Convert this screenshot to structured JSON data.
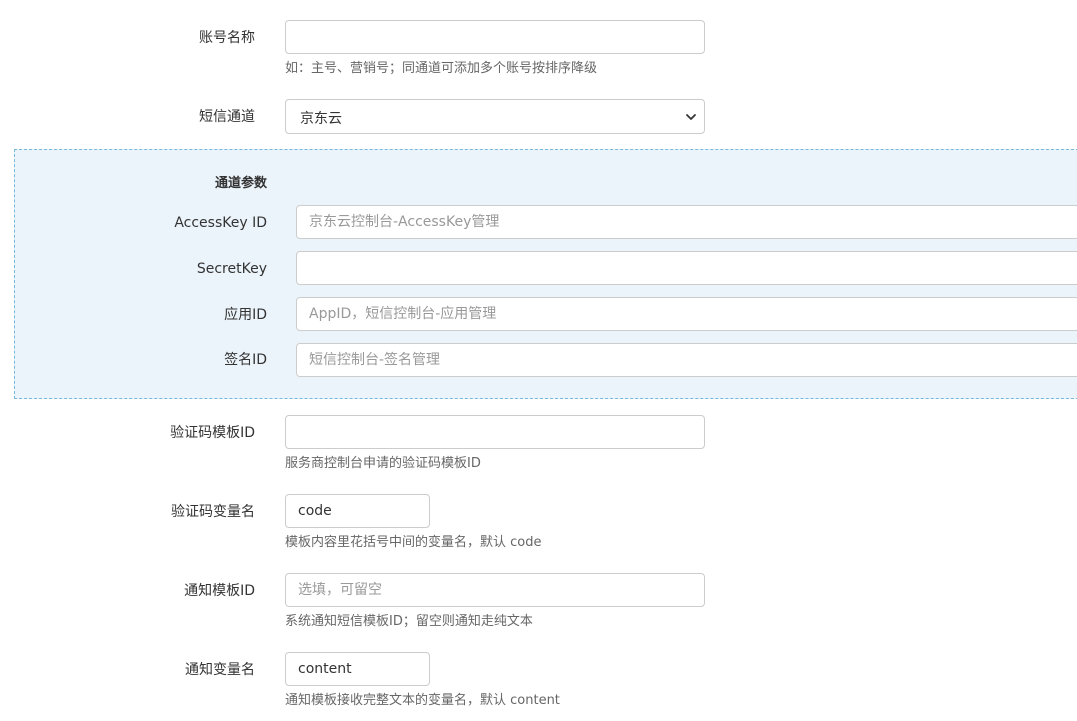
{
  "account_name": {
    "label": "账号名称",
    "value": "",
    "help": "如：主号、营销号；同通道可添加多个账号按排序降级"
  },
  "channel": {
    "label": "短信通道",
    "selected": "京东云"
  },
  "params": {
    "title": "通道参数",
    "access_key": {
      "label": "AccessKey ID",
      "placeholder": "京东云控制台-AccessKey管理"
    },
    "secret_key": {
      "label": "SecretKey",
      "placeholder": ""
    },
    "app_id": {
      "label": "应用ID",
      "placeholder": "AppID，短信控制台-应用管理"
    },
    "sign_id": {
      "label": "签名ID",
      "placeholder": "短信控制台-签名管理"
    }
  },
  "verify_template": {
    "label": "验证码模板ID",
    "value": "",
    "help": "服务商控制台申请的验证码模板ID"
  },
  "verify_var": {
    "label": "验证码变量名",
    "value": "code",
    "help": "模板内容里花括号中间的变量名，默认 code"
  },
  "notify_template": {
    "label": "通知模板ID",
    "placeholder": "选填，可留空",
    "help": "系统通知短信模板ID；留空则通知走纯文本"
  },
  "notify_var": {
    "label": "通知变量名",
    "value": "content",
    "help": "通知模板接收完整文本的变量名，默认 content"
  }
}
